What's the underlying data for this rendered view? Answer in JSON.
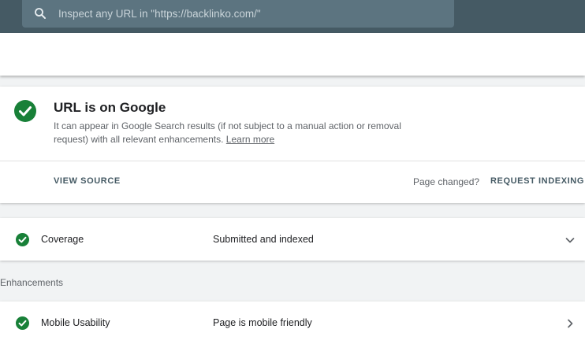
{
  "search": {
    "placeholder": "Inspect any URL in \"https://backlinko.com/\"",
    "icon": "search-icon"
  },
  "status_card": {
    "title": "URL is on Google",
    "description": "It can appear in Google Search results (if not subject to a manual action or removal request) with all relevant enhancements.",
    "learn_more": "Learn more",
    "view_source": "VIEW SOURCE",
    "page_changed": "Page changed?",
    "request_indexing": "REQUEST INDEXING",
    "status_icon": "check-circle-icon",
    "status_color": "#188038"
  },
  "coverage": {
    "label": "Coverage",
    "value": "Submitted and indexed",
    "icon": "chevron-down-icon"
  },
  "enhancements": {
    "heading": "Enhancements",
    "items": [
      {
        "label": "Mobile Usability",
        "value": "Page is mobile friendly",
        "icon": "chevron-right-icon"
      }
    ]
  },
  "colors": {
    "header": "#455a64",
    "success": "#188038"
  }
}
